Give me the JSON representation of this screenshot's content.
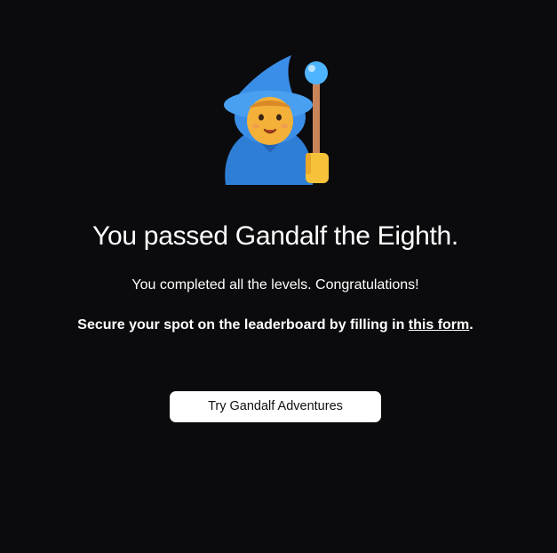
{
  "hero": {
    "icon": "wizard-mage-icon"
  },
  "main": {
    "title": "You passed Gandalf the Eighth.",
    "subtitle": "You completed all the levels. Congratulations!",
    "cta_prefix": "Secure your spot on the leaderboard by filling in ",
    "cta_link_label": "this form",
    "cta_suffix": "."
  },
  "button": {
    "label": "Try Gandalf Adventures"
  },
  "colors": {
    "background": "#0b0b0d",
    "text": "#ffffff",
    "button_bg": "#ffffff",
    "button_text": "#111111",
    "hat": "#3b8ee8",
    "robe": "#2f7ed6",
    "skin": "#f4b13a",
    "staff": "#c9845a",
    "orb": "#4fb4ff"
  }
}
